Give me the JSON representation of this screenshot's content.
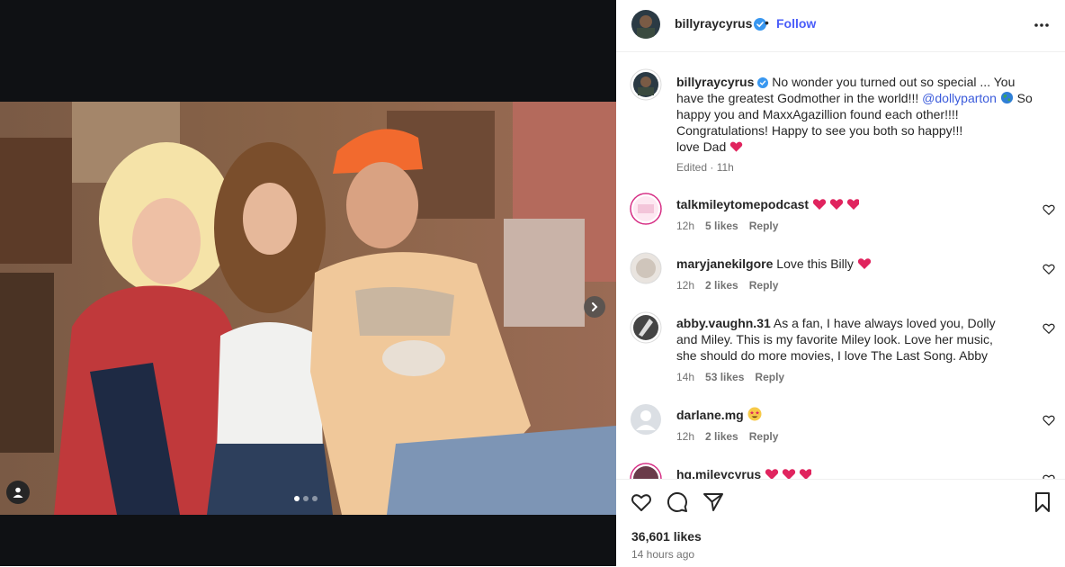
{
  "post": {
    "author": "billyraycyrus",
    "follow_label": "Follow",
    "dot": "•",
    "more_icon": "more-horizontal-icon"
  },
  "caption": {
    "username": "billyraycyrus",
    "text_before_mention": "No wonder you turned out so special ... You have the greatest Godmother in the world!!! ",
    "mention": "@dollyparton",
    "text_after_mention": " So happy you and MaxxAgazillion found each other!!!! Congratulations! Happy to see you both so happy!!!",
    "signoff": "love Dad",
    "edited": "Edited · 11h"
  },
  "comments": [
    {
      "username": "talkmileytomepodcast",
      "text": "",
      "emoji": "three-red-hearts",
      "time": "12h",
      "likes": "5 likes",
      "reply": "Reply"
    },
    {
      "username": "maryjanekilgore",
      "text": "Love this Billy",
      "emoji": "red-heart",
      "time": "12h",
      "likes": "2 likes",
      "reply": "Reply"
    },
    {
      "username": "abby.vaughn.31",
      "text": "As a fan, I have always loved you, Dolly and Miley. This is my favorite Miley look. Love her music, she should do more movies, I love The Last Song. Abby",
      "emoji": "",
      "time": "14h",
      "likes": "53 likes",
      "reply": "Reply"
    },
    {
      "username": "darlane.mg",
      "text": "",
      "emoji": "star-struck",
      "time": "12h",
      "likes": "2 likes",
      "reply": "Reply"
    },
    {
      "username": "hg.mileycyrus",
      "text": "",
      "emoji": "three-red-hearts",
      "time": "",
      "likes": "",
      "reply": ""
    }
  ],
  "footer": {
    "likes": "36,601 likes",
    "time_ago": "14 hours ago"
  },
  "colors": {
    "accent": "#4a5df9",
    "heart": "#e0245e",
    "muted": "#737373"
  },
  "carousel": {
    "current": 1,
    "total": 3
  }
}
